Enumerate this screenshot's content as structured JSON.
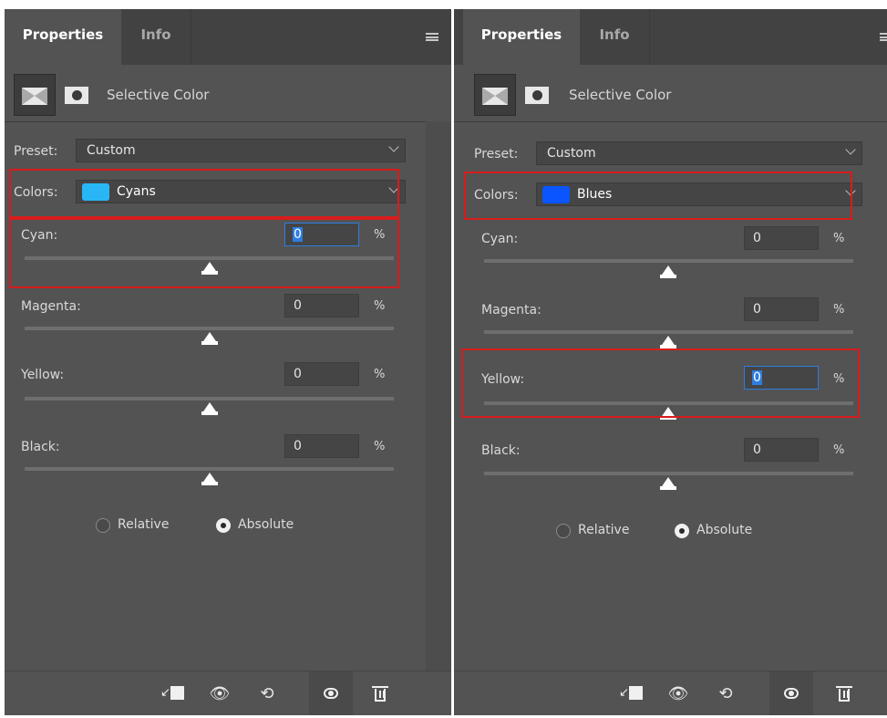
{
  "panels": [
    {
      "tab_active": "Properties",
      "tab_inactive": "Info",
      "adjustment_title": "Selective Color",
      "preset_label": "Preset:",
      "preset_value": "Custom",
      "colors_label": "Colors:",
      "colors_value": "Cyans",
      "swatch_color": "#29b6f6",
      "cyan_label": "Cyan:",
      "cyan_value": "0",
      "magenta_label": "Magenta:",
      "magenta_value": "0",
      "yellow_label": "Yellow:",
      "yellow_value": "0",
      "black_label": "Black:",
      "black_value": "0",
      "percent": "%",
      "relative_label": "Relative",
      "absolute_label": "Absolute",
      "focused_field": "cyan"
    },
    {
      "tab_active": "Properties",
      "tab_inactive": "Info",
      "adjustment_title": "Selective Color",
      "preset_label": "Preset:",
      "preset_value": "Custom",
      "colors_label": "Colors:",
      "colors_value": "Blues",
      "swatch_color": "#0a55ff",
      "cyan_label": "Cyan:",
      "cyan_value": "0",
      "magenta_label": "Magenta:",
      "magenta_value": "0",
      "yellow_label": "Yellow:",
      "yellow_value": "0",
      "black_label": "Black:",
      "black_value": "0",
      "percent": "%",
      "relative_label": "Relative",
      "absolute_label": "Absolute",
      "focused_field": "yellow"
    }
  ],
  "colors": {
    "panel_bg": "#535353",
    "highlight_red": "#d91c1c",
    "focus_blue": "#2d7de0"
  },
  "icons": [
    "adjustment-layer-icon",
    "mask-icon",
    "panel-menu-icon",
    "clip-to-layer-icon",
    "view-previous-state-icon",
    "reset-icon",
    "visibility-eye-icon",
    "trash-icon"
  ]
}
